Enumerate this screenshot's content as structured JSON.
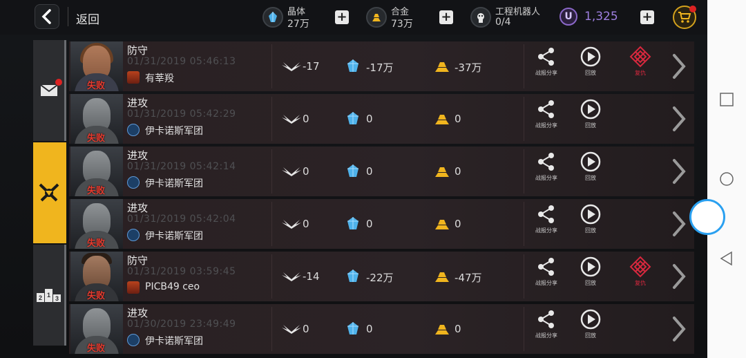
{
  "header": {
    "back_label": "返回",
    "resources": [
      {
        "name": "晶体",
        "value": "27万",
        "icon": "crystal-icon"
      },
      {
        "name": "合金",
        "value": "73万",
        "icon": "alloy-icon"
      },
      {
        "name": "工程机器人",
        "value": "0/4",
        "icon": "engineer-robot-icon"
      }
    ],
    "premium": {
      "symbol": "U",
      "value": "1,325"
    },
    "plus_symbol": "+"
  },
  "sidetabs": [
    {
      "name": "mail",
      "icon": "mail-icon",
      "badge": true,
      "active": false
    },
    {
      "name": "battle",
      "icon": "crossed-swords-icon",
      "badge": false,
      "active": true
    },
    {
      "name": "ranking",
      "icon": "podium-icon",
      "badge": false,
      "active": false,
      "podium": [
        "2",
        "1",
        "3"
      ]
    }
  ],
  "actions": {
    "share": "战报分享",
    "replay": "回放",
    "revenge": "复仇"
  },
  "rows": [
    {
      "mode": "防守",
      "time": "01/31/2019 05:46:13",
      "guild": "有莘羖",
      "guild_type": "red",
      "avatar": "woman",
      "result": "失败",
      "pilots": "-17",
      "crystal": "-17万",
      "alloy": "-37万",
      "revenge": true
    },
    {
      "mode": "进攻",
      "time": "01/31/2019 05:42:29",
      "guild": "伊卡诺斯军团",
      "guild_type": "blue",
      "avatar": "robot",
      "result": "失败",
      "pilots": "0",
      "crystal": "0",
      "alloy": "0",
      "revenge": false
    },
    {
      "mode": "进攻",
      "time": "01/31/2019 05:42:14",
      "guild": "伊卡诺斯军团",
      "guild_type": "blue",
      "avatar": "robot",
      "result": "失败",
      "pilots": "0",
      "crystal": "0",
      "alloy": "0",
      "revenge": false
    },
    {
      "mode": "进攻",
      "time": "01/31/2019 05:42:04",
      "guild": "伊卡诺斯军团",
      "guild_type": "blue",
      "avatar": "robot",
      "result": "失败",
      "pilots": "0",
      "crystal": "0",
      "alloy": "0",
      "revenge": false
    },
    {
      "mode": "防守",
      "time": "01/31/2019 03:59:45",
      "guild": "PICB49 ceo",
      "guild_type": "red",
      "avatar": "man",
      "result": "失败",
      "pilots": "-14",
      "crystal": "-22万",
      "alloy": "-47万",
      "revenge": true
    },
    {
      "mode": "进攻",
      "time": "01/30/2019 23:49:49",
      "guild": "伊卡诺斯军团",
      "guild_type": "blue",
      "avatar": "robot",
      "result": "失败",
      "pilots": "0",
      "crystal": "0",
      "alloy": "0",
      "revenge": false
    }
  ],
  "colors": {
    "accent": "#f0b51e",
    "defeat": "#e53b2f",
    "premium": "#9e7fe0",
    "revenge": "#d8283e"
  }
}
